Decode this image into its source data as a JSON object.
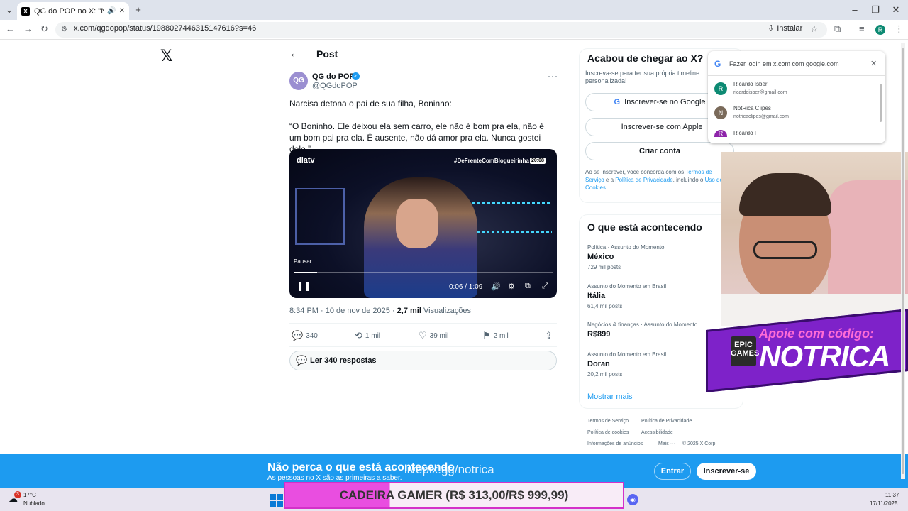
{
  "browser": {
    "tab_title": "QG do POP no X: \"Narcisa",
    "url": "x.com/qgdopop/status/1988027446315147616?s=46",
    "install_label": "Instalar",
    "profile_initial": "R"
  },
  "x": {
    "header_title": "Post",
    "author": {
      "name": "QG do POP",
      "handle": "@QGdoPOP",
      "avatar_text": "QG"
    },
    "post_lines": [
      "Narcisa detona o pai de sua filha, Boninho:",
      "“O Boninho. Ele deixou ela sem carro, ele não é bom pra ela, não é um bom pai pra ela. É ausente, não dá amor pra ela. Nunca gostei dele.”"
    ],
    "video": {
      "logo": "diatv",
      "hashtag": "#DeFrenteComBlogueirinha",
      "badge": "20:08",
      "pause_tooltip": "Pausar",
      "time": "0:06 / 1:09",
      "progress": 0.087
    },
    "meta": {
      "time": "8:34 PM · 10 de nov de 2025 · ",
      "views_count": "2,7 mil",
      "views_label": " Visualizações"
    },
    "actions": {
      "replies": "340",
      "reposts": "1 mil",
      "likes": "39 mil",
      "bookmarks": "2 mil"
    },
    "read_replies": "Ler 340 respostas",
    "signup": {
      "title": "Acabou de chegar ao X?",
      "subtitle": "Inscreva-se para ter sua própria timeline personalizada!",
      "google_btn": "Inscrever-se no Google",
      "apple_btn": "Inscrever-se com Apple",
      "create_btn": "Criar conta",
      "legal_prefix": "Ao se inscrever, você concorda com os ",
      "legal_terms": "Termos de Serviço",
      "legal_and": " e a ",
      "legal_privacy": "Política de Privacidade",
      "legal_including": ", incluindo o ",
      "legal_cookies": "Uso de Cookies",
      "legal_end": "."
    },
    "trends": {
      "title": "O que está acontecendo",
      "items": [
        {
          "category": "Política · Assunto do Momento",
          "name": "México",
          "posts": "729 mil posts"
        },
        {
          "category": "Assunto do Momento em Brasil",
          "name": "Itália",
          "posts": "61,4 mil posts"
        },
        {
          "category": "Negócios & finanças · Assunto do Momento",
          "name": "R$899",
          "posts": ""
        },
        {
          "category": "Assunto do Momento em Brasil",
          "name": "Doran",
          "posts": "20,2 mil posts"
        }
      ],
      "show_more": "Mostrar mais"
    },
    "footer": {
      "terms": "Termos de Serviço",
      "privacy": "Política de Privacidade",
      "cookies": "Política de cookies",
      "accessibility": "Acessibilidade",
      "ads": "Informações de anúncios",
      "more": "Mais ···",
      "copyright": "© 2025 X Corp."
    },
    "banner": {
      "title": "Não perca o que está acontecendo",
      "subtitle": "As pessoas no X são as primeiras a saber.",
      "login": "Entrar",
      "signup": "Inscrever-se"
    }
  },
  "google_onetap": {
    "title": "Fazer login em x.com com google.com",
    "accounts": [
      {
        "initial": "R",
        "name": "Ricardo Isber",
        "email": "ricardoisber@gmail.com",
        "color": "#0d8a73"
      },
      {
        "initial": "N",
        "name": "NotRica Clipes",
        "email": "notricaclipes@gmail.com",
        "color": "#7a6a5a"
      },
      {
        "initial": "R",
        "name": "Ricardo I",
        "email": "",
        "color": "#8e24aa"
      }
    ]
  },
  "overlay": {
    "stream_url": "livepix.gg/notrica",
    "promo_top": "Apoie com código:",
    "promo_main": "NOTRICA",
    "epic_logo": "EPIC GAMES",
    "chair_ad": "CADEIRA GAMER (R$ 313,00/R$ 999,99)"
  },
  "taskbar": {
    "temp": "17°C",
    "weather": "Nublado",
    "weather_badge": "3",
    "time": "11:37",
    "date": "17/11/2025"
  }
}
